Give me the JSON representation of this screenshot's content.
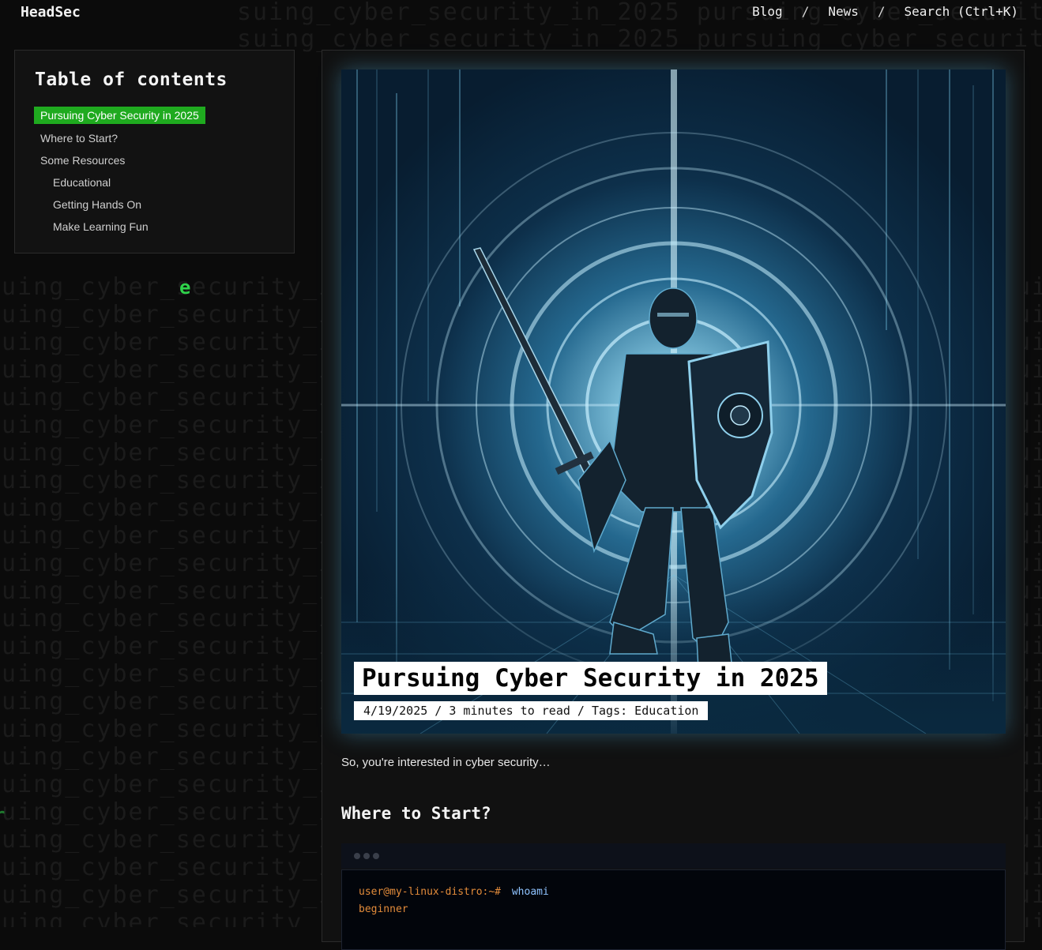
{
  "header": {
    "brand": "HeadSec",
    "nav": [
      {
        "label": "Blog"
      },
      {
        "label": "News"
      },
      {
        "label": "Search (Ctrl+K)"
      }
    ],
    "separator": "/"
  },
  "background": {
    "rain_text": "suing_cyber_security_in_2025 pursuing_cyber_security_in_2025 pursuing_cyber_security",
    "glyph": "e",
    "edge_glyph": "r"
  },
  "toc": {
    "title": "Table of contents",
    "items": [
      {
        "label": "Pursuing Cyber Security in 2025",
        "level": 1,
        "active": true
      },
      {
        "label": "Where to Start?",
        "level": 1,
        "active": false
      },
      {
        "label": "Some Resources",
        "level": 1,
        "active": false
      },
      {
        "label": "Educational",
        "level": 2,
        "active": false
      },
      {
        "label": "Getting Hands On",
        "level": 2,
        "active": false
      },
      {
        "label": "Make Learning Fun",
        "level": 2,
        "active": false
      }
    ]
  },
  "article": {
    "hero_image": "armored knight with sword and shield in front of glowing cyber portal",
    "title": "Pursuing Cyber Security in 2025",
    "meta": "4/19/2025 / 3 minutes to read / Tags: Education",
    "intro": "So, you're interested in cyber security…",
    "section_heading": "Where to Start?",
    "terminal": {
      "prompt": "user@my-linux-distro:~#",
      "command": "whoami",
      "output": "beginner"
    }
  },
  "colors": {
    "accent_green": "#1faa1f",
    "prompt_orange": "#e28b3a",
    "command_blue": "#8fc3ff"
  }
}
